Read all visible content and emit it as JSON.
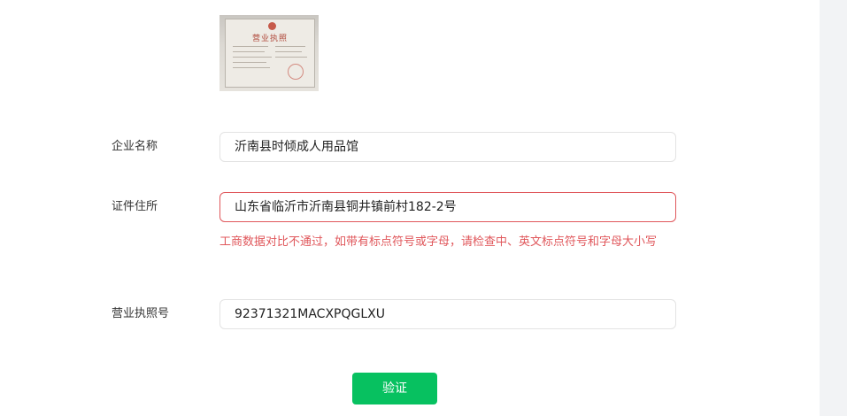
{
  "license_image": {
    "title_text": "营业执照"
  },
  "form": {
    "company_name": {
      "label": "企业名称",
      "value": "沂南县时倾成人用品馆"
    },
    "address": {
      "label": "证件住所",
      "value": "山东省临沂市沂南县铜井镇前村182-2号",
      "error": "工商数据对比不通过，如带有标点符号或字母，请检查中、英文标点符号和字母大小写"
    },
    "license_number": {
      "label": "营业执照号",
      "value": "92371321MACXPQGLXU"
    }
  },
  "verify_button": {
    "label": "验证"
  },
  "colors": {
    "accent": "#07c160",
    "error": "#e0575b",
    "border": "#e3e3e3"
  }
}
